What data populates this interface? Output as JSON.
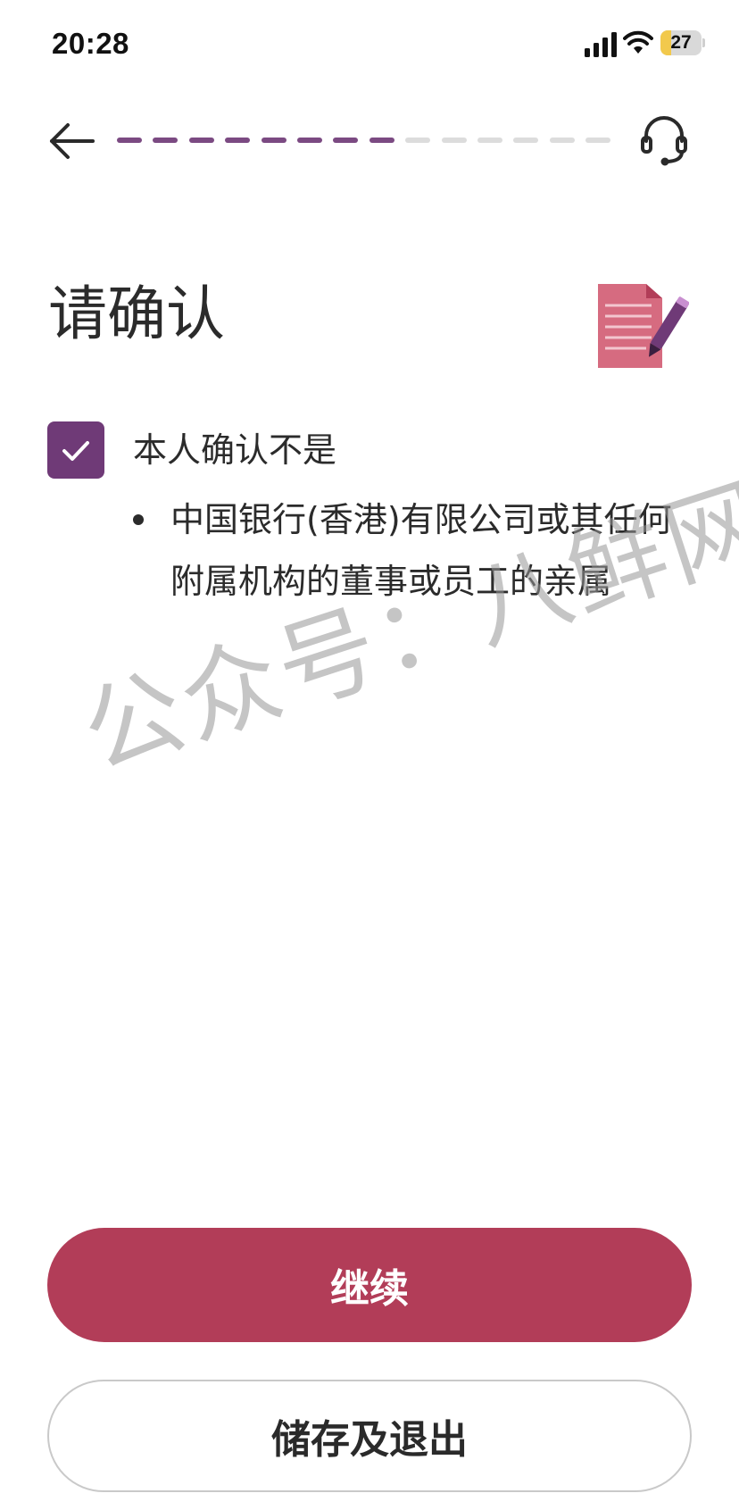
{
  "status_bar": {
    "time": "20:28",
    "battery_level": "27",
    "battery_fraction": 0.27,
    "icons": [
      "signal-icon",
      "wifi-icon",
      "battery-icon"
    ]
  },
  "header": {
    "back_icon": "arrow-left-icon",
    "support_icon": "headset-icon",
    "progress": {
      "completed_steps": 8,
      "total_steps": 14,
      "active_color": "#7b4a82",
      "inactive_color": "#dcdcdc"
    }
  },
  "main": {
    "title": "请确认",
    "title_icon": "document-pen-icon",
    "confirmation": {
      "checked": true,
      "label": "本人确认不是",
      "bullets": [
        "中国银行(香港)有限公司或其任何附属机构的董事或员工的亲属"
      ]
    },
    "watermark": "公众号：八鲜网"
  },
  "actions": {
    "continue_label": "继续",
    "save_exit_label": "储存及退出"
  },
  "colors": {
    "brand_primary": "#b23d58",
    "checkbox": "#6f3a77"
  }
}
